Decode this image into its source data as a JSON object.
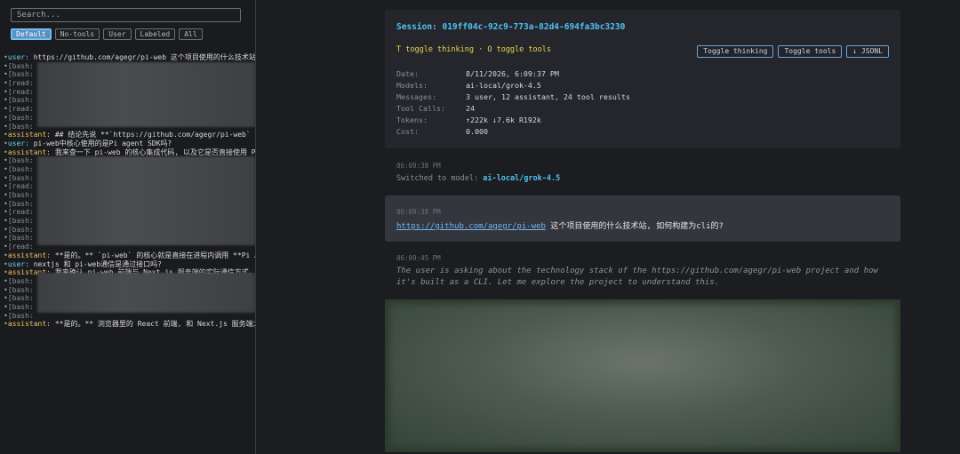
{
  "sidebar": {
    "search_placeholder": "Search...",
    "filters": [
      "Default",
      "No-tools",
      "User",
      "Labeled",
      "All"
    ],
    "active_filter": "Default",
    "tree": [
      {
        "kind": "user",
        "label": "user:",
        "text": " https://github.com/agegr/pi-web 这个项目使用的什么技术站"
      },
      {
        "kind": "tool",
        "label": "[bash:",
        "text": ""
      },
      {
        "kind": "tool",
        "label": "[bash:",
        "text": ""
      },
      {
        "kind": "tool",
        "label": "[read:",
        "text": ""
      },
      {
        "kind": "tool",
        "label": "[read:",
        "text": ""
      },
      {
        "kind": "tool",
        "label": "[bash:",
        "text": ""
      },
      {
        "kind": "tool",
        "label": "[read:",
        "text": ""
      },
      {
        "kind": "tool",
        "label": "[bash:",
        "text": ""
      },
      {
        "kind": "tool",
        "label": "[bash:",
        "text": ""
      },
      {
        "kind": "assistant",
        "label": "assistant:",
        "text": " ## 结论先说 **`https://github.com/agegr/pi-web` 这"
      },
      {
        "kind": "user",
        "label": "user:",
        "text": " pi-web中核心使用的是Pi agent SDK吗?"
      },
      {
        "kind": "assistant",
        "label": "assistant:",
        "text": " 我来查一下 pi-web 的核心集成代码, 以及它是否直接使用 Pi"
      },
      {
        "kind": "tool",
        "label": "[bash:",
        "text": ""
      },
      {
        "kind": "tool",
        "label": "[bash:",
        "text": ""
      },
      {
        "kind": "tool",
        "label": "[bash:",
        "text": ""
      },
      {
        "kind": "tool",
        "label": "[read:",
        "text": ""
      },
      {
        "kind": "tool",
        "label": "[bash:",
        "text": ""
      },
      {
        "kind": "tool",
        "label": "[bash:",
        "text": ""
      },
      {
        "kind": "tool",
        "label": "[read:",
        "text": ""
      },
      {
        "kind": "tool",
        "label": "[bash:",
        "text": ""
      },
      {
        "kind": "tool",
        "label": "[bash:",
        "text": ""
      },
      {
        "kind": "tool",
        "label": "[bash:",
        "text": ""
      },
      {
        "kind": "tool",
        "label": "[read:",
        "text": ""
      },
      {
        "kind": "assistant",
        "label": "assistant:",
        "text": " **是的。** `pi-web` 的核心就是直接在进程内调用 **Pi A"
      },
      {
        "kind": "user",
        "label": "user:",
        "text": " nextjs 和 pi-web通信是通过接口吗?"
      },
      {
        "kind": "assistant",
        "label": "assistant:",
        "text": " 我来确认 pi-web 前端与 Next.js 服务端的实际通信方式。"
      },
      {
        "kind": "tool",
        "label": "[bash:",
        "text": ""
      },
      {
        "kind": "tool",
        "label": "[bash:",
        "text": ""
      },
      {
        "kind": "tool",
        "label": "[bash:",
        "text": ""
      },
      {
        "kind": "tool",
        "label": "[bash:",
        "text": ""
      },
      {
        "kind": "tool",
        "label": "[bash:",
        "text": ""
      },
      {
        "kind": "assistant",
        "label": "assistant:",
        "text": " **是的。** 浏览器里的 React 前端, 和 Next.js 服务端之"
      }
    ]
  },
  "header": {
    "session": "Session: 019ff04c-92c9-773a-82d4-694fa3bc3230",
    "hint": "T toggle thinking · O toggle tools",
    "buttons": [
      "Toggle thinking",
      "Toggle tools",
      "↓ JSONL"
    ],
    "meta": [
      {
        "k": "Date:",
        "v": "8/11/2026, 6:09:37 PM"
      },
      {
        "k": "Models:",
        "v": "ai-local/grok-4.5"
      },
      {
        "k": "Messages:",
        "v": "3 user, 12 assistant, 24 tool results"
      },
      {
        "k": "Tool Calls:",
        "v": "24"
      },
      {
        "k": "Tokens:",
        "v": "↑222k ↓7.6k R192k"
      },
      {
        "k": "Cost:",
        "v": "0.000"
      }
    ]
  },
  "events": {
    "model_switch": {
      "time": "06:09:38 PM",
      "prefix": "Switched to model: ",
      "model": "ai-local/grok-4.5"
    },
    "user_message": {
      "time": "06:09:38 PM",
      "link": "https://github.com/agegr/pi-web",
      "text": " 这个项目使用的什么技术站, 如何构建为cli的?"
    },
    "thinking": {
      "time": "06:09:45 PM",
      "text": "The user is asking about the technology stack of the https://github.com/agegr/pi-web project and how it's built as a CLI. Let me explore the project to understand this."
    }
  }
}
